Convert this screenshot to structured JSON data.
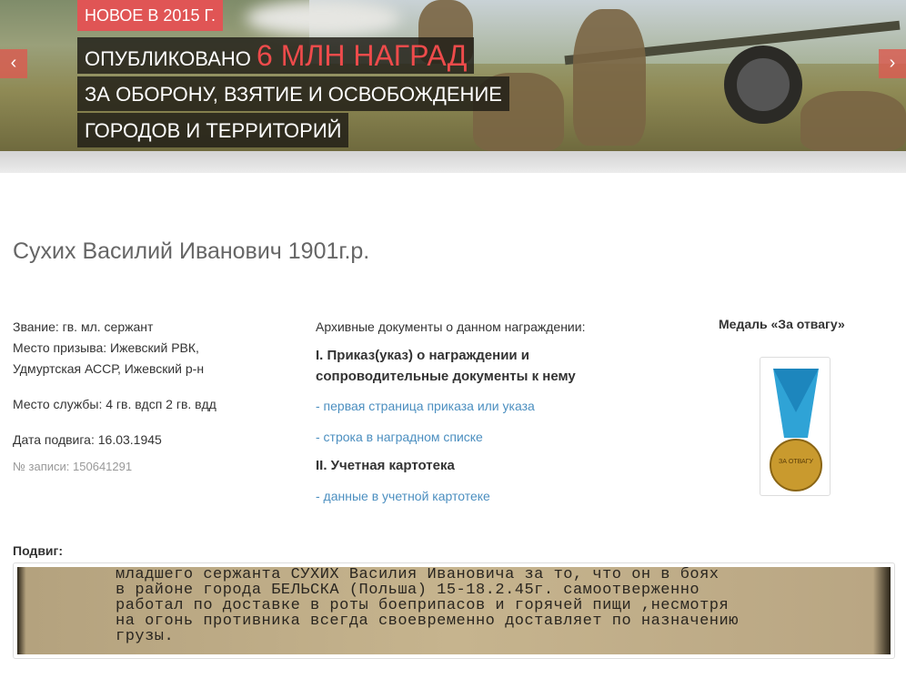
{
  "banner": {
    "badge": "НОВОЕ В 2015 Г.",
    "line1_prefix": "ОПУБЛИКОВАНО ",
    "line1_highlight": "6 МЛН НАГРАД",
    "line2": "ЗА ОБОРОНУ, ВЗЯТИЕ И ОСВОБОЖДЕНИЕ",
    "line3": "ГОРОДОВ И ТЕРРИТОРИЙ",
    "prev": "‹",
    "next": "›"
  },
  "person": {
    "name": "Сухих Василий Иванович 1901г.р.",
    "rank": "Звание: гв. мл. сержант",
    "draft_place_1": "Место призыва: Ижевский РВК,",
    "draft_place_2": "Удмуртская АССР, Ижевский р-н",
    "service": "Место службы: 4 гв. вдсп 2 гв. вдд",
    "date": "Дата подвига: 16.03.1945",
    "record": "№ записи: 150641291"
  },
  "docs": {
    "intro": "Архивные документы о данном награждении:",
    "section1": "I. Приказ(указ) о награждении и сопроводительные документы к нему",
    "link1": "- первая страница приказа или указа",
    "link2": "- строка в наградном списке",
    "section2": "II. Учетная картотека",
    "link3": "- данные в учетной картотеке"
  },
  "medal": {
    "title": "Медаль «За отвагу»",
    "inscription": "ЗА ОТВАГУ"
  },
  "feat": {
    "label": "Подвиг:",
    "text": "младшего сержанта СУХИХ Василия Ивановича за то, что он в боях\nв районе города БЕЛЬСКА (Польша) 15-18.2.45г. самоотверженно\nработал по доставке в роты боеприпасов и горячей пищи ,несмотря\nна огонь противника всегда своевременно доставляет по назначению\nгрузы."
  }
}
